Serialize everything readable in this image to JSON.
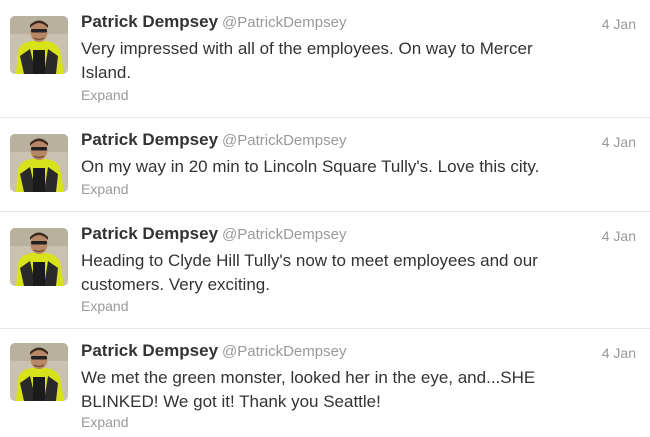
{
  "timeline": {
    "tweets": [
      {
        "name": "Patrick Dempsey",
        "handle": "@PatrickDempsey",
        "time": "4 Jan",
        "text": "Very impressed with all of the employees. On way to Mercer Island.",
        "action": "Expand",
        "avatar_icon": "profile-photo-driver"
      },
      {
        "name": "Patrick Dempsey",
        "handle": "@PatrickDempsey",
        "time": "4 Jan",
        "text": "On my way in 20 min to Lincoln Square Tully's. Love this city.",
        "action": "Expand",
        "avatar_icon": "profile-photo-driver"
      },
      {
        "name": "Patrick Dempsey",
        "handle": "@PatrickDempsey",
        "time": "4 Jan",
        "text": "Heading to Clyde Hill Tully's now to meet employees and our customers. Very exciting.",
        "action": "Expand",
        "avatar_icon": "profile-photo-driver"
      },
      {
        "name": "Patrick Dempsey",
        "handle": "@PatrickDempsey",
        "time": "4 Jan",
        "text": "We met the green monster, looked her in the eye, and...SHE BLINKED! We got it! Thank you Seattle!",
        "action": "Expand",
        "avatar_icon": "profile-photo-driver"
      }
    ]
  },
  "colors": {
    "name": "#333333",
    "meta": "#999999",
    "divider": "#e8e8e8",
    "avatar_suit": "#d8e21a"
  }
}
